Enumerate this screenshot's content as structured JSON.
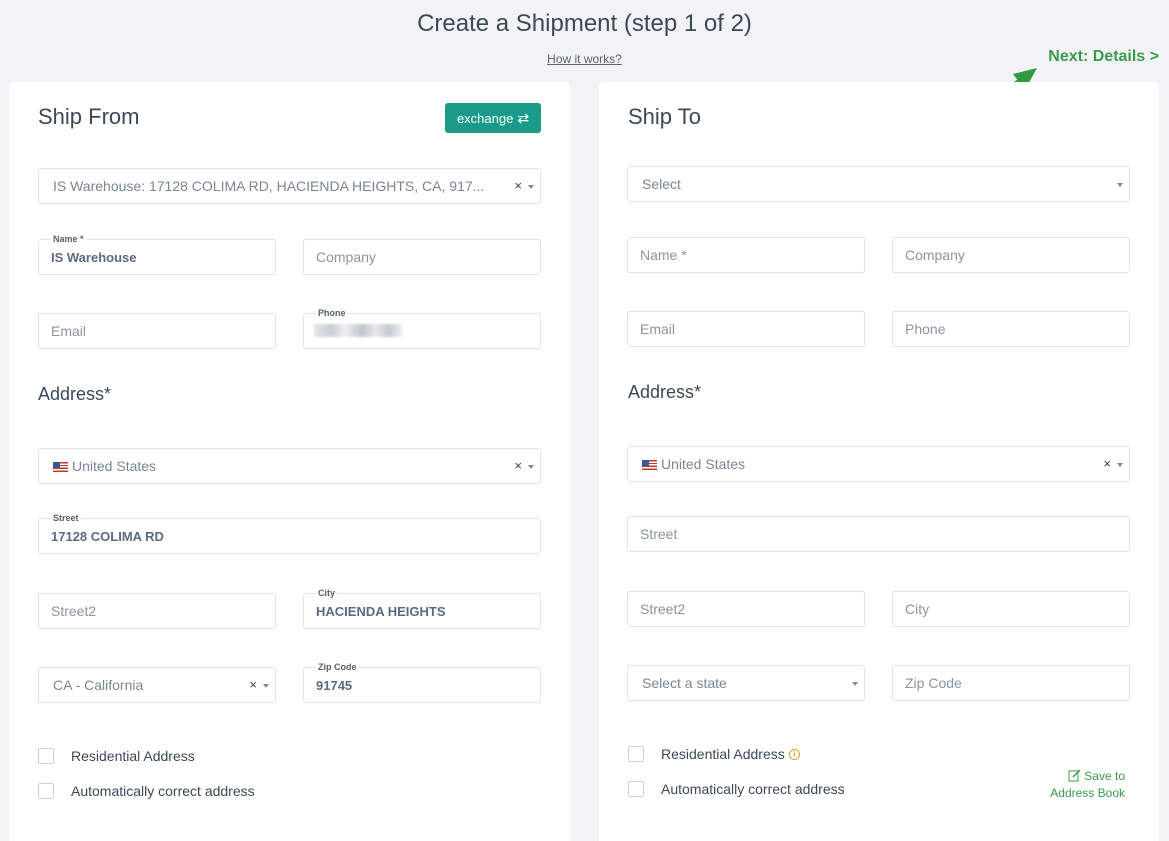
{
  "header": {
    "title": "Create a Shipment (step 1 of 2)",
    "how_link": "How it works?",
    "next_link": "Next: Details >"
  },
  "ship_from": {
    "title": "Ship From",
    "exchange_label": "exchange",
    "warehouse_select": "IS Warehouse: 17128 COLIMA RD, HACIENDA HEIGHTS, CA, 917...",
    "name": {
      "label": "Name *",
      "value": "IS Warehouse"
    },
    "company": {
      "placeholder": "Company"
    },
    "email": {
      "placeholder": "Email"
    },
    "phone": {
      "label": "Phone"
    },
    "address_title": "Address*",
    "country": "United States",
    "street": {
      "label": "Street",
      "value": "17128 COLIMA RD"
    },
    "street2": {
      "placeholder": "Street2"
    },
    "city": {
      "label": "City",
      "value": "HACIENDA HEIGHTS"
    },
    "state": "CA - California",
    "zip": {
      "label": "Zip Code",
      "value": "91745"
    },
    "residential_label": "Residential Address",
    "auto_correct_label": "Automatically correct address"
  },
  "ship_to": {
    "title": "Ship To",
    "select_placeholder": "Select",
    "name": {
      "placeholder": "Name *"
    },
    "company": {
      "placeholder": "Company"
    },
    "email": {
      "placeholder": "Email"
    },
    "phone": {
      "placeholder": "Phone"
    },
    "address_title": "Address*",
    "country": "United States",
    "street": {
      "placeholder": "Street"
    },
    "street2": {
      "placeholder": "Street2"
    },
    "city": {
      "placeholder": "City"
    },
    "state_placeholder": "Select a state",
    "zip": {
      "placeholder": "Zip Code"
    },
    "residential_label": "Residential Address",
    "auto_correct_label": "Automatically correct address",
    "save_line1": "Save to",
    "save_line2": "Address Book"
  },
  "colors": {
    "accent_teal": "#1a9b8a",
    "link_green": "#3a9b4c",
    "background": "#f3f3f7"
  },
  "icons": [
    "exchange-icon",
    "clear-icon",
    "chevron-down-icon",
    "us-flag-icon",
    "info-icon",
    "edit-icon",
    "annotation-arrow"
  ]
}
